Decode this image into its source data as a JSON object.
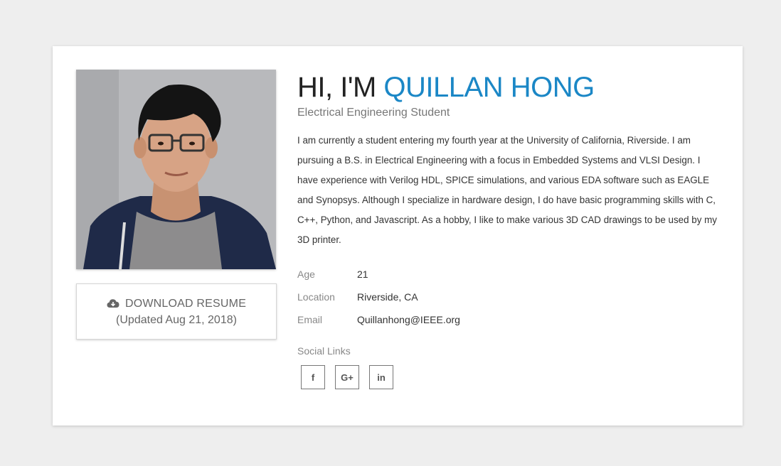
{
  "profile": {
    "greeting": "HI, I'M",
    "name": "QUILLAN HONG",
    "subtitle": "Electrical Engineering Student",
    "bio": "I am currently a student entering my fourth year at the University of California, Riverside. I am pursuing a B.S. in Electrical Engineering with a focus in Embedded Systems and VLSI Design. I have experience with Verilog HDL, SPICE simulations, and various EDA software such as EAGLE and Synopsys. Although I specialize in hardware design, I do have basic programming skills with C, C++, Python, and Javascript. As a hobby, I like to make various 3D CAD drawings to be used by my 3D printer."
  },
  "resume": {
    "label": "DOWNLOAD RESUME",
    "updated": "(Updated Aug 21, 2018)",
    "icon": "cloud-download-icon"
  },
  "info": [
    {
      "label": "Age",
      "value": "21"
    },
    {
      "label": "Location",
      "value": "Riverside, CA"
    },
    {
      "label": "Email",
      "value": "Quillanhong@IEEE.org"
    }
  ],
  "social": {
    "title": "Social Links",
    "links": [
      {
        "icon": "facebook-icon",
        "glyph": "f"
      },
      {
        "icon": "google-plus-icon",
        "glyph": "G+"
      },
      {
        "icon": "linkedin-icon",
        "glyph": "in"
      }
    ]
  },
  "colors": {
    "accent": "#1b87c6",
    "background": "#eeeeee",
    "card": "#ffffff"
  }
}
